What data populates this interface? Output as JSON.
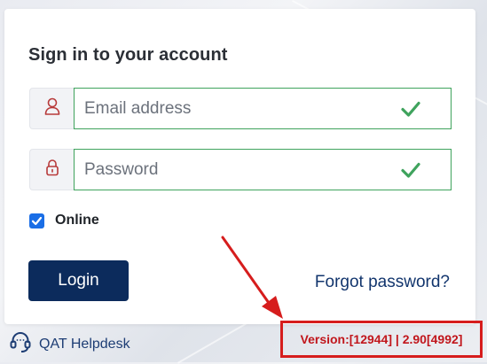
{
  "login": {
    "title": "Sign in to your account",
    "email_placeholder": "Email address",
    "password_placeholder": "Password",
    "online_label": "Online",
    "online_checked": true,
    "login_label": "Login",
    "forgot_label": "Forgot password?"
  },
  "icons": {
    "email": "user-icon",
    "password": "lock-icon",
    "valid": "check-icon",
    "helpdesk": "headset-icon"
  },
  "footer": {
    "helpdesk_label": "QAT Helpdesk",
    "version": "Version:[12944] | 2.90[4992]"
  },
  "colors": {
    "primary": "#0c2b5c",
    "valid": "#3fa35d",
    "checkbox": "#1a6ee6",
    "icon": "#b73a3a",
    "annotation": "#d61d1d"
  }
}
